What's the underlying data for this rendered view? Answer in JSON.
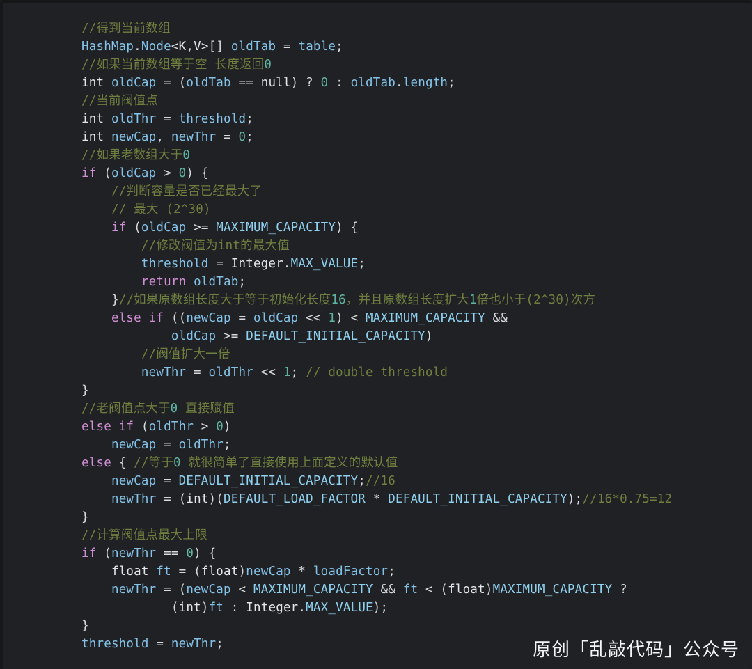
{
  "editor": {
    "language": "java",
    "theme": "dark",
    "background_color": "#202124",
    "token_colors": {
      "plain": "#dfe3e7",
      "keyword": "#d08fd4",
      "identifier": "#84c2e8",
      "constant": "#8fd0ee",
      "number": "#5fb3a1",
      "comment": "#6f7f3f",
      "punctuation": "#d7dade"
    },
    "lines": [
      {
        "indent": 0,
        "tokens": [
          {
            "c": "cmt",
            "t": "//得到当前数组"
          }
        ]
      },
      {
        "indent": 0,
        "tokens": [
          {
            "c": "ident",
            "t": "HashMap"
          },
          {
            "c": "punct",
            "t": "."
          },
          {
            "c": "ident",
            "t": "Node"
          },
          {
            "c": "punct",
            "t": "<"
          },
          {
            "c": "plain",
            "t": "K"
          },
          {
            "c": "punct",
            "t": ","
          },
          {
            "c": "plain",
            "t": "V"
          },
          {
            "c": "punct",
            "t": ">[] "
          },
          {
            "c": "ident",
            "t": "oldTab"
          },
          {
            "c": "punct",
            "t": " = "
          },
          {
            "c": "ident",
            "t": "table"
          },
          {
            "c": "punct",
            "t": ";"
          }
        ]
      },
      {
        "indent": 0,
        "tokens": [
          {
            "c": "cmt",
            "t": "//如果当前数组等于空 长度返回"
          },
          {
            "c": "num",
            "t": "0"
          }
        ]
      },
      {
        "indent": 0,
        "tokens": [
          {
            "c": "type",
            "t": "int "
          },
          {
            "c": "ident",
            "t": "oldCap"
          },
          {
            "c": "punct",
            "t": " = ("
          },
          {
            "c": "ident",
            "t": "oldTab"
          },
          {
            "c": "punct",
            "t": " == "
          },
          {
            "c": "type",
            "t": "null"
          },
          {
            "c": "punct",
            "t": ") ? "
          },
          {
            "c": "num",
            "t": "0"
          },
          {
            "c": "punct",
            "t": " : "
          },
          {
            "c": "ident",
            "t": "oldTab"
          },
          {
            "c": "punct",
            "t": "."
          },
          {
            "c": "ident",
            "t": "length"
          },
          {
            "c": "punct",
            "t": ";"
          }
        ]
      },
      {
        "indent": 0,
        "tokens": [
          {
            "c": "cmt",
            "t": "//当前阀值点"
          }
        ]
      },
      {
        "indent": 0,
        "tokens": [
          {
            "c": "type",
            "t": "int "
          },
          {
            "c": "ident",
            "t": "oldThr"
          },
          {
            "c": "punct",
            "t": " = "
          },
          {
            "c": "ident",
            "t": "threshold"
          },
          {
            "c": "punct",
            "t": ";"
          }
        ]
      },
      {
        "indent": 0,
        "tokens": [
          {
            "c": "type",
            "t": "int "
          },
          {
            "c": "ident",
            "t": "newCap"
          },
          {
            "c": "punct",
            "t": ", "
          },
          {
            "c": "ident",
            "t": "newThr"
          },
          {
            "c": "punct",
            "t": " = "
          },
          {
            "c": "num",
            "t": "0"
          },
          {
            "c": "punct",
            "t": ";"
          }
        ]
      },
      {
        "indent": 0,
        "tokens": [
          {
            "c": "cmt",
            "t": "//如果老数组大于"
          },
          {
            "c": "num",
            "t": "0"
          }
        ]
      },
      {
        "indent": 0,
        "tokens": [
          {
            "c": "kw",
            "t": "if"
          },
          {
            "c": "punct",
            "t": " ("
          },
          {
            "c": "ident",
            "t": "oldCap"
          },
          {
            "c": "punct",
            "t": " > "
          },
          {
            "c": "num",
            "t": "0"
          },
          {
            "c": "punct",
            "t": ") {"
          }
        ]
      },
      {
        "indent": 1,
        "tokens": [
          {
            "c": "cmt",
            "t": "//判断容量是否已经最大了"
          }
        ]
      },
      {
        "indent": 1,
        "tokens": [
          {
            "c": "cmt",
            "t": "// 最大 (2^30)"
          }
        ]
      },
      {
        "indent": 1,
        "tokens": [
          {
            "c": "kw",
            "t": "if"
          },
          {
            "c": "punct",
            "t": " ("
          },
          {
            "c": "ident",
            "t": "oldCap"
          },
          {
            "c": "punct",
            "t": " >= "
          },
          {
            "c": "const",
            "t": "MAXIMUM_CAPACITY"
          },
          {
            "c": "punct",
            "t": ") {"
          }
        ]
      },
      {
        "indent": 2,
        "tokens": [
          {
            "c": "cmt",
            "t": "//修改阀值为int的最大值"
          }
        ]
      },
      {
        "indent": 2,
        "tokens": [
          {
            "c": "ident",
            "t": "threshold"
          },
          {
            "c": "punct",
            "t": " = "
          },
          {
            "c": "type",
            "t": "Integer"
          },
          {
            "c": "punct",
            "t": "."
          },
          {
            "c": "const",
            "t": "MAX_VALUE"
          },
          {
            "c": "punct",
            "t": ";"
          }
        ]
      },
      {
        "indent": 2,
        "tokens": [
          {
            "c": "kw",
            "t": "return"
          },
          {
            "c": "punct",
            "t": " "
          },
          {
            "c": "ident",
            "t": "oldTab"
          },
          {
            "c": "punct",
            "t": ";"
          }
        ]
      },
      {
        "indent": 1,
        "tokens": [
          {
            "c": "punct",
            "t": "}"
          },
          {
            "c": "cmt",
            "t": "//如果原数组长度大于等于初始化长度"
          },
          {
            "c": "num",
            "t": "16"
          },
          {
            "c": "cmt",
            "t": "，并且原数组长度扩大"
          },
          {
            "c": "num",
            "t": "1"
          },
          {
            "c": "cmt",
            "t": "倍也小于(2^30)次方"
          }
        ]
      },
      {
        "indent": 1,
        "tokens": [
          {
            "c": "kw",
            "t": "else if"
          },
          {
            "c": "punct",
            "t": " (("
          },
          {
            "c": "ident",
            "t": "newCap"
          },
          {
            "c": "punct",
            "t": " = "
          },
          {
            "c": "ident",
            "t": "oldCap"
          },
          {
            "c": "punct",
            "t": " << "
          },
          {
            "c": "num",
            "t": "1"
          },
          {
            "c": "punct",
            "t": ") < "
          },
          {
            "c": "const",
            "t": "MAXIMUM_CAPACITY"
          },
          {
            "c": "punct",
            "t": " &&"
          }
        ]
      },
      {
        "indent": 3,
        "tokens": [
          {
            "c": "ident",
            "t": "oldCap"
          },
          {
            "c": "punct",
            "t": " >= "
          },
          {
            "c": "const",
            "t": "DEFAULT_INITIAL_CAPACITY"
          },
          {
            "c": "punct",
            "t": ")"
          }
        ]
      },
      {
        "indent": 2,
        "tokens": [
          {
            "c": "cmt",
            "t": "//阀值扩大一倍"
          }
        ]
      },
      {
        "indent": 2,
        "tokens": [
          {
            "c": "ident",
            "t": "newThr"
          },
          {
            "c": "punct",
            "t": " = "
          },
          {
            "c": "ident",
            "t": "oldThr"
          },
          {
            "c": "punct",
            "t": " << "
          },
          {
            "c": "num",
            "t": "1"
          },
          {
            "c": "punct",
            "t": "; "
          },
          {
            "c": "cmt",
            "t": "// double threshold"
          }
        ]
      },
      {
        "indent": 0,
        "tokens": [
          {
            "c": "punct",
            "t": "}"
          }
        ]
      },
      {
        "indent": 0,
        "tokens": [
          {
            "c": "cmt",
            "t": "//老阀值点大于"
          },
          {
            "c": "num",
            "t": "0"
          },
          {
            "c": "cmt",
            "t": " 直接赋值"
          }
        ]
      },
      {
        "indent": 0,
        "tokens": [
          {
            "c": "kw",
            "t": "else if"
          },
          {
            "c": "punct",
            "t": " ("
          },
          {
            "c": "ident",
            "t": "oldThr"
          },
          {
            "c": "punct",
            "t": " > "
          },
          {
            "c": "num",
            "t": "0"
          },
          {
            "c": "punct",
            "t": ")"
          }
        ]
      },
      {
        "indent": 1,
        "tokens": [
          {
            "c": "ident",
            "t": "newCap"
          },
          {
            "c": "punct",
            "t": " = "
          },
          {
            "c": "ident",
            "t": "oldThr"
          },
          {
            "c": "punct",
            "t": ";"
          }
        ]
      },
      {
        "indent": 0,
        "tokens": [
          {
            "c": "kw",
            "t": "else"
          },
          {
            "c": "punct",
            "t": " { "
          },
          {
            "c": "cmt",
            "t": "//等于"
          },
          {
            "c": "num",
            "t": "0"
          },
          {
            "c": "cmt",
            "t": " 就很简单了直接使用上面定义的默认值"
          }
        ]
      },
      {
        "indent": 1,
        "tokens": [
          {
            "c": "ident",
            "t": "newCap"
          },
          {
            "c": "punct",
            "t": " = "
          },
          {
            "c": "const",
            "t": "DEFAULT_INITIAL_CAPACITY"
          },
          {
            "c": "punct",
            "t": ";"
          },
          {
            "c": "cmt",
            "t": "//16"
          }
        ]
      },
      {
        "indent": 1,
        "tokens": [
          {
            "c": "ident",
            "t": "newThr"
          },
          {
            "c": "punct",
            "t": " = ("
          },
          {
            "c": "type",
            "t": "int"
          },
          {
            "c": "punct",
            "t": ")("
          },
          {
            "c": "const",
            "t": "DEFAULT_LOAD_FACTOR"
          },
          {
            "c": "punct",
            "t": " * "
          },
          {
            "c": "const",
            "t": "DEFAULT_INITIAL_CAPACITY"
          },
          {
            "c": "punct",
            "t": ");"
          },
          {
            "c": "cmt",
            "t": "//16*0.75=12"
          }
        ]
      },
      {
        "indent": 0,
        "tokens": [
          {
            "c": "punct",
            "t": "}"
          }
        ]
      },
      {
        "indent": 0,
        "tokens": [
          {
            "c": "cmt",
            "t": "//计算阀值点最大上限"
          }
        ]
      },
      {
        "indent": 0,
        "tokens": [
          {
            "c": "kw",
            "t": "if"
          },
          {
            "c": "punct",
            "t": " ("
          },
          {
            "c": "ident",
            "t": "newThr"
          },
          {
            "c": "punct",
            "t": " == "
          },
          {
            "c": "num",
            "t": "0"
          },
          {
            "c": "punct",
            "t": ") {"
          }
        ]
      },
      {
        "indent": 1,
        "tokens": [
          {
            "c": "type",
            "t": "float "
          },
          {
            "c": "ident",
            "t": "ft"
          },
          {
            "c": "punct",
            "t": " = ("
          },
          {
            "c": "type",
            "t": "float"
          },
          {
            "c": "punct",
            "t": ")"
          },
          {
            "c": "ident",
            "t": "newCap"
          },
          {
            "c": "punct",
            "t": " * "
          },
          {
            "c": "ident",
            "t": "loadFactor"
          },
          {
            "c": "punct",
            "t": ";"
          }
        ]
      },
      {
        "indent": 1,
        "tokens": [
          {
            "c": "ident",
            "t": "newThr"
          },
          {
            "c": "punct",
            "t": " = ("
          },
          {
            "c": "ident",
            "t": "newCap"
          },
          {
            "c": "punct",
            "t": " < "
          },
          {
            "c": "const",
            "t": "MAXIMUM_CAPACITY"
          },
          {
            "c": "punct",
            "t": " && "
          },
          {
            "c": "ident",
            "t": "ft"
          },
          {
            "c": "punct",
            "t": " < ("
          },
          {
            "c": "type",
            "t": "float"
          },
          {
            "c": "punct",
            "t": ")"
          },
          {
            "c": "const",
            "t": "MAXIMUM_CAPACITY"
          },
          {
            "c": "punct",
            "t": " ?"
          }
        ]
      },
      {
        "indent": 3,
        "tokens": [
          {
            "c": "punct",
            "t": "("
          },
          {
            "c": "type",
            "t": "int"
          },
          {
            "c": "punct",
            "t": ")"
          },
          {
            "c": "ident",
            "t": "ft"
          },
          {
            "c": "punct",
            "t": " : "
          },
          {
            "c": "type",
            "t": "Integer"
          },
          {
            "c": "punct",
            "t": "."
          },
          {
            "c": "const",
            "t": "MAX_VALUE"
          },
          {
            "c": "punct",
            "t": ");"
          }
        ]
      },
      {
        "indent": 0,
        "tokens": [
          {
            "c": "punct",
            "t": "}"
          }
        ]
      },
      {
        "indent": 0,
        "tokens": [
          {
            "c": "ident",
            "t": "threshold"
          },
          {
            "c": "punct",
            "t": " = "
          },
          {
            "c": "ident",
            "t": "newThr"
          },
          {
            "c": "punct",
            "t": ";"
          }
        ]
      }
    ]
  },
  "watermark": {
    "text": "原创「乱敲代码」公众号"
  }
}
